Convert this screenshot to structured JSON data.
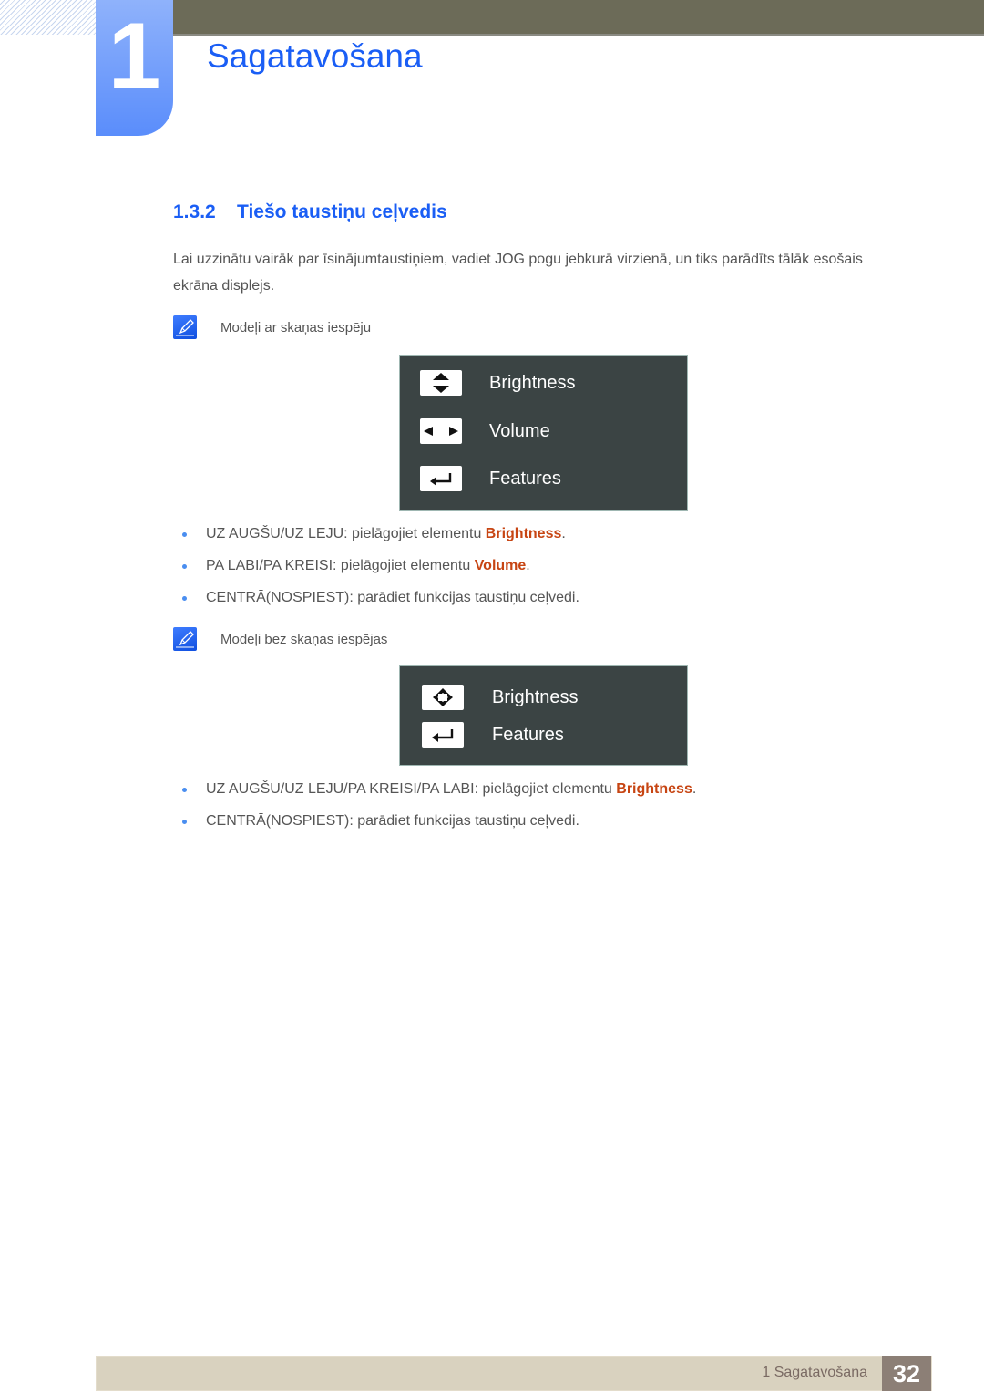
{
  "header": {
    "chapter_number": "1",
    "chapter_title": "Sagatavošana"
  },
  "section": {
    "number": "1.3.2",
    "title": "Tiešo taustiņu ceļvedis"
  },
  "intro": "Lai uzzinātu vairāk par īsinājumtaustiņiem, vadiet JOG pogu jebkurā virzienā, un tiks parādīts tālāk esošais ekrāna displejs.",
  "note1": {
    "icon": "note-pencil-icon",
    "text": "Modeļi ar skaņas iespēju"
  },
  "osd1": {
    "items": [
      {
        "icon": "up-down-arrows-icon",
        "label": "Brightness"
      },
      {
        "icon": "left-right-arrows-icon",
        "label": "Volume"
      },
      {
        "icon": "enter-return-icon",
        "label": "Features"
      }
    ]
  },
  "bullets1": [
    {
      "text": "UZ AUGŠU/UZ LEJU: pielāgojiet elementu ",
      "highlight": "Brightness",
      "suffix": "."
    },
    {
      "text": "PA LABI/PA KREISI: pielāgojiet elementu ",
      "highlight": "Volume",
      "suffix": "."
    },
    {
      "text": "CENTRĀ(NOSPIEST): parādiet funkcijas taustiņu ceļvedi.",
      "highlight": "",
      "suffix": ""
    }
  ],
  "note2": {
    "icon": "note-pencil-icon",
    "text": "Modeļi bez skaņas iespējas"
  },
  "osd2": {
    "items": [
      {
        "icon": "four-way-arrows-icon",
        "label": "Brightness"
      },
      {
        "icon": "enter-return-icon",
        "label": "Features"
      }
    ]
  },
  "bullets2": [
    {
      "text": "UZ AUGŠU/UZ LEJU/PA KREISI/PA LABI: pielāgojiet elementu ",
      "highlight": "Brightness",
      "suffix": "."
    },
    {
      "text": "CENTRĀ(NOSPIEST): parādiet funkcijas taustiņu ceļvedi.",
      "highlight": "",
      "suffix": ""
    }
  ],
  "footer": {
    "label": "1 Sagatavošana",
    "page_number": "32"
  },
  "colors": {
    "accent_blue": "#1a5ef5",
    "highlight_orange": "#c74513",
    "osd_background": "#3b4444",
    "header_bar": "#6c6b58",
    "footer_bar": "#d9d2bf",
    "page_badge": "#8c7f76"
  }
}
